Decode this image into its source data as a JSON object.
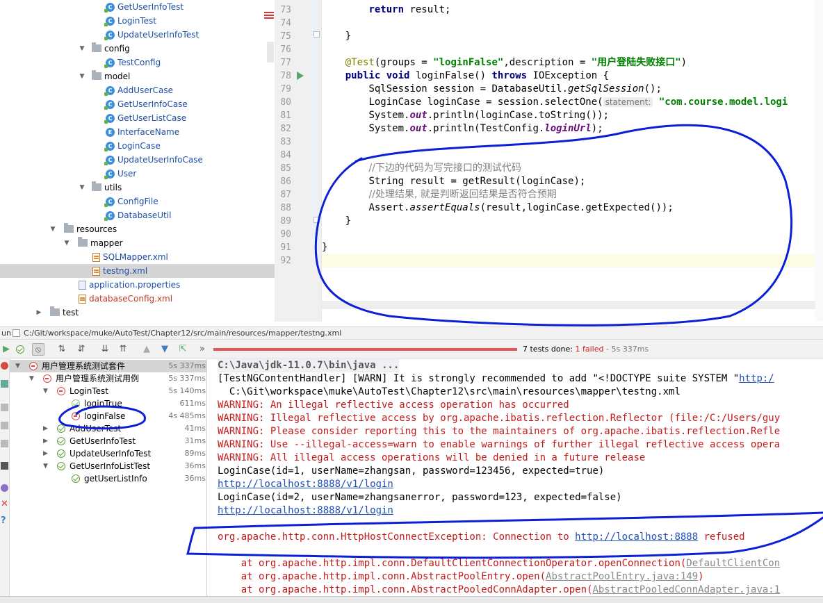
{
  "project_tree": {
    "items": [
      {
        "label": "GetUserInfoTest",
        "type": "class"
      },
      {
        "label": "LoginTest",
        "type": "class"
      },
      {
        "label": "UpdateUserInfoTest",
        "type": "class"
      },
      {
        "label": "config",
        "type": "package"
      },
      {
        "label": "TestConfig",
        "type": "class"
      },
      {
        "label": "model",
        "type": "package"
      },
      {
        "label": "AddUserCase",
        "type": "class"
      },
      {
        "label": "GetUserInfoCase",
        "type": "class"
      },
      {
        "label": "GetUserListCase",
        "type": "class"
      },
      {
        "label": "InterfaceName",
        "type": "enum"
      },
      {
        "label": "LoginCase",
        "type": "class"
      },
      {
        "label": "UpdateUserInfoCase",
        "type": "class"
      },
      {
        "label": "User",
        "type": "class"
      },
      {
        "label": "utils",
        "type": "package"
      },
      {
        "label": "ConfigFile",
        "type": "class"
      },
      {
        "label": "DatabaseUtil",
        "type": "class"
      },
      {
        "label": "resources",
        "type": "folder"
      },
      {
        "label": "mapper",
        "type": "folder"
      },
      {
        "label": "SQLMapper.xml",
        "type": "xml"
      },
      {
        "label": "testng.xml",
        "type": "xml"
      },
      {
        "label": "application.properties",
        "type": "properties"
      },
      {
        "label": "databaseConfig.xml",
        "type": "xml"
      },
      {
        "label": "test",
        "type": "folder"
      }
    ]
  },
  "editor": {
    "line_numbers": [
      "73",
      "74",
      "75",
      "76",
      "77",
      "78",
      "79",
      "80",
      "81",
      "82",
      "83",
      "84",
      "85",
      "86",
      "87",
      "88",
      "89",
      "90",
      "91",
      "92"
    ],
    "l73": {
      "kw": "return",
      "rest": " result;"
    },
    "l75": "}",
    "l77": {
      "ann": "@Test",
      "p1": "(groups = ",
      "s1": "\"loginFalse\"",
      "p2": ",description = ",
      "s2": "\"用户登陆失败接口\"",
      "p3": ")"
    },
    "l78": {
      "kw1": "public",
      "kw2": "void",
      "name": " loginFalse() ",
      "kw3": "throws",
      "rest": " IOException {"
    },
    "l79": {
      "a": "SqlSession session = DatabaseUtil.",
      "b": "getSqlSession",
      "c": "();"
    },
    "l80": {
      "a": "LoginCase loginCase = session.selectOne(",
      "hint": "statement:",
      "s": "\"com.course.model.logi"
    },
    "l81": {
      "a": "System.",
      "b": "out",
      "c": ".println(loginCase.toString());"
    },
    "l82": {
      "a": "System.",
      "b": "out",
      "c": ".println(TestConfig.",
      "d": "loginUrl",
      "e": ");"
    },
    "l85": "//下边的代码为写完接口的测试代码",
    "l86": "String result = getResult(loginCase);",
    "l87": "//处理结果, 就是判断返回结果是否符合预期",
    "l88": {
      "a": "Assert.",
      "b": "assertEquals",
      "c": "(result,loginCase.getExpected());"
    },
    "l89": "}",
    "l91": "}"
  },
  "run_bar": {
    "prefix": "un",
    "path": "C:/Git/workspace/muke/AutoTest/Chapter12/src/main/resources/mapper/testng.xml"
  },
  "run_status": {
    "done": "7 tests done:",
    "failed": "1 failed",
    "time": "- 5s 337ms"
  },
  "test_tree": {
    "rows": [
      {
        "label": "用户管理系统测试套件",
        "time": "5s 337ms",
        "status": "fail"
      },
      {
        "label": "用户管理系统测试用例",
        "time": "5s 337ms",
        "status": "fail"
      },
      {
        "label": "LoginTest",
        "time": "5s 140ms",
        "status": "fail"
      },
      {
        "label": "loginTrue",
        "time": "611ms",
        "status": "pass"
      },
      {
        "label": "loginFalse",
        "time": "4s 485ms",
        "status": "fail"
      },
      {
        "label": "AddUserTest",
        "time": "41ms",
        "status": "pass"
      },
      {
        "label": "GetUserInfoTest",
        "time": "31ms",
        "status": "pass"
      },
      {
        "label": "UpdateUserInfoTest",
        "time": "89ms",
        "status": "pass"
      },
      {
        "label": "GetUserInfoListTest",
        "time": "36ms",
        "status": "pass"
      },
      {
        "label": "getUserListInfo",
        "time": "36ms",
        "status": "pass"
      }
    ]
  },
  "console": {
    "l1": "C:\\Java\\jdk-11.0.7\\bin\\java ...",
    "l2a": "[TestNGContentHandler] [WARN] It is strongly recommended to add \"<!DOCTYPE suite SYSTEM \"",
    "l2b": "http:/",
    "l3": "  C:\\Git\\workspace\\muke\\AutoTest\\Chapter12\\src\\main\\resources\\mapper\\testng.xml",
    "l4": "WARNING: An illegal reflective access operation has occurred",
    "l5": "WARNING: Illegal reflective access by org.apache.ibatis.reflection.Reflector (file:/C:/Users/guy",
    "l6": "WARNING: Please consider reporting this to the maintainers of org.apache.ibatis.reflection.Refle",
    "l7": "WARNING: Use --illegal-access=warn to enable warnings of further illegal reflective access opera",
    "l8": "WARNING: All illegal access operations will be denied in a future release",
    "l9": "LoginCase(id=1, userName=zhangsan, password=123456, expected=true)",
    "l10": "http://localhost:8888/v1/login",
    "l11": "LoginCase(id=2, userName=zhangsanerror, password=123, expected=false)",
    "l12": "http://localhost:8888/v1/login",
    "l14a": "org.apache.http.conn.HttpHostConnectException: Connection to ",
    "l14b": "http://localhost:8888",
    "l14c": " refused",
    "l16a": "    at org.apache.http.impl.conn.DefaultClientConnectionOperator.openConnection(",
    "l16b": "DefaultClientCon",
    "l17a": "    at org.apache.http.impl.conn.AbstractPoolEntry.open(",
    "l17b": "AbstractPoolEntry.java:149",
    "l17c": ")",
    "l18a": "    at org.apache.http.impl.conn.AbstractPooledConnAdapter.open(",
    "l18b": "AbstractPooledConnAdapter.java:1"
  },
  "colors": {
    "accent_fail": "#d8493f",
    "accent_pass": "#5a9e3a",
    "annotation_ink": "#0a1fd6"
  }
}
